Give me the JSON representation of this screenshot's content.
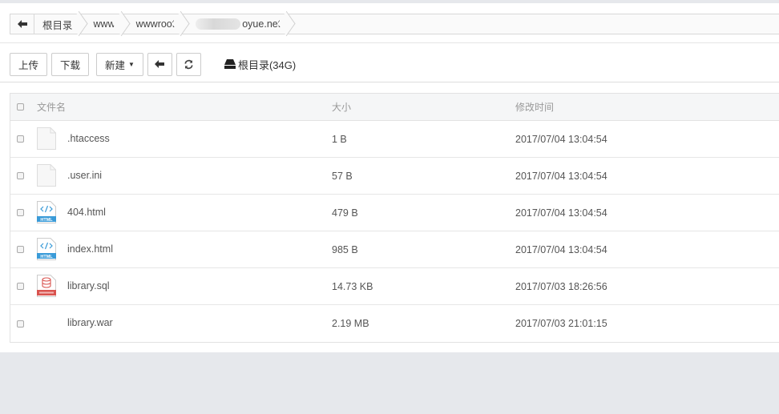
{
  "breadcrumb": {
    "items": [
      "根目录",
      "www",
      "wwwroot",
      "oyue.net"
    ]
  },
  "toolbar": {
    "upload": "上传",
    "download": "下载",
    "new": "新建",
    "disk_label": "根目录(34G)"
  },
  "table": {
    "headers": {
      "name": "文件名",
      "size": "大小",
      "time": "修改时间"
    },
    "rows": [
      {
        "name": ".htaccess",
        "size": "1 B",
        "time": "2017/07/04 13:04:54",
        "icon": "blank-file-icon"
      },
      {
        "name": ".user.ini",
        "size": "57 B",
        "time": "2017/07/04 13:04:54",
        "icon": "blank-file-icon"
      },
      {
        "name": "404.html",
        "size": "479 B",
        "time": "2017/07/04 13:04:54",
        "icon": "html-file-icon"
      },
      {
        "name": "index.html",
        "size": "985 B",
        "time": "2017/07/04 13:04:54",
        "icon": "html-file-icon"
      },
      {
        "name": "library.sql",
        "size": "14.73 KB",
        "time": "2017/07/03 18:26:56",
        "icon": "database-file-icon"
      },
      {
        "name": "library.war",
        "size": "2.19 MB",
        "time": "2017/07/03 21:01:15",
        "icon": "none"
      }
    ]
  },
  "colors": {
    "html_icon": "#3a9bd8",
    "sql_icon": "#d9534f",
    "header_bg": "#f5f6f7"
  }
}
